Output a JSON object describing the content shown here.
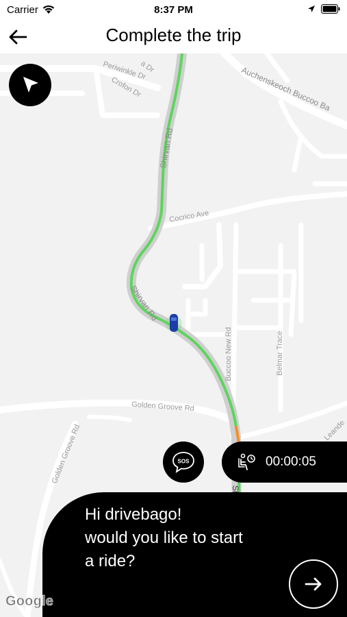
{
  "status_bar": {
    "carrier": "Carrier",
    "time": "8:37 PM"
  },
  "header": {
    "title": "Complete the trip"
  },
  "map": {
    "streets": {
      "periwinkle": "Periwinkle Dr",
      "a_dr": "a Dr",
      "crofon": "Crofon Dr",
      "auchenskeoch": "Auchenskeoch Buccoo Ba",
      "shirvan_top": "Shirvan Rd",
      "cocrico": "Cocrico Ave",
      "shirvan_mid": "Shirvan Rd",
      "buccoo_new": "Buccoo New Rd",
      "belmar": "Belmar Trace",
      "golden_groove": "Golden Groove Rd",
      "golden_groove_left": "Golden Groove Rd",
      "leande": "Leande",
      "shi": "Shi"
    },
    "route_color": "#5cd65c",
    "route_end_color": "#f0902a",
    "car_color": "#1b3fa6",
    "attribution": "Google"
  },
  "sos": {
    "label": "SOS"
  },
  "timer": {
    "value": "00:00:05",
    "icon": "seated-passenger-icon"
  },
  "prompt": {
    "line1": "Hi drivebago!",
    "line2": "would you like to start",
    "line3": "a ride?"
  },
  "icons": {
    "back": "arrow-left-icon",
    "locate": "navigation-arrow-icon",
    "go": "arrow-right-icon"
  }
}
